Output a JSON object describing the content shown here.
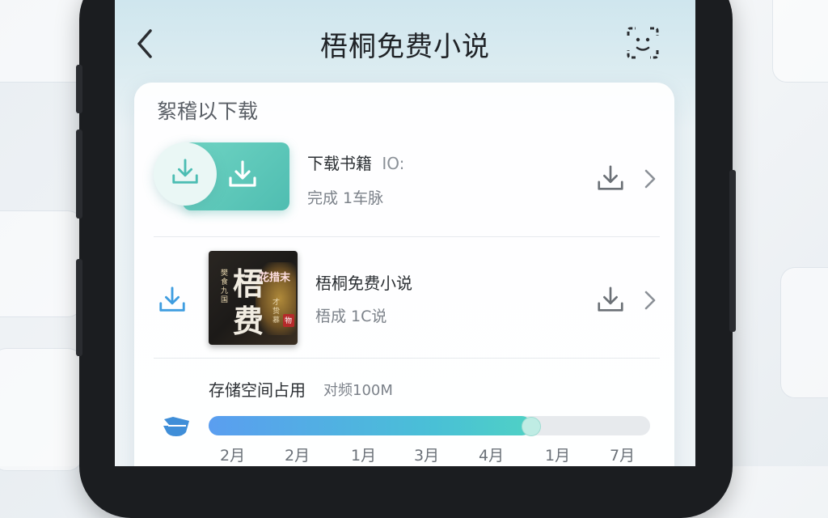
{
  "header": {
    "title": "梧桐免费小说"
  },
  "section": {
    "title": "絮稽以下载"
  },
  "items": [
    {
      "title": "下载书籍",
      "title_extra": "IO:",
      "subtitle": "完成 1车脉"
    },
    {
      "title": "梧桐免费小说",
      "subtitle": "梧成 1C说"
    }
  ],
  "cover": {
    "big_chars": [
      "梧",
      "费"
    ],
    "left_text": "樊食九国",
    "right_text": "才贽慕",
    "tag": "花措末",
    "badge": "物"
  },
  "storage": {
    "title": "存储空间占用",
    "quota": "对频100M",
    "progress": 0.73,
    "months": [
      "2月",
      "2月",
      "1月",
      "3月",
      "4月",
      "1月",
      "7月"
    ]
  },
  "colors": {
    "accent": "#4fbdb1",
    "blue": "#4a9fe0",
    "bar_start": "#5a9ef0",
    "bar_end": "#4fd1c5"
  }
}
